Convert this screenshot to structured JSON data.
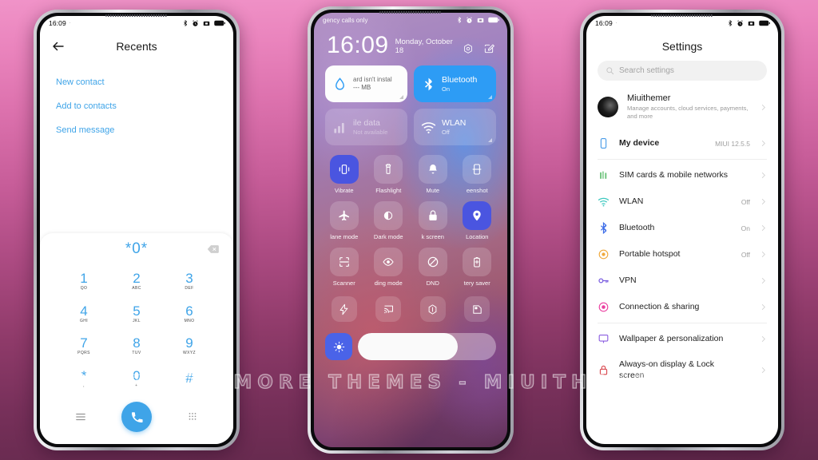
{
  "background": {
    "top_color": "#f093c8",
    "bottom_color": "#63294c"
  },
  "watermark": {
    "text": "VISIT FOR MORE THEMES - MIUITHEMER.COM"
  },
  "phone_left": {
    "statusbar": {
      "time": "16:09",
      "dot": "·",
      "icons": [
        "bluetooth-icon",
        "alarm-icon",
        "sd-card-icon",
        "battery-icon"
      ]
    },
    "dialer": {
      "back_icon": "back-arrow-icon",
      "title": "Recents",
      "actions": [
        {
          "label": "New contact"
        },
        {
          "label": "Add to contacts"
        },
        {
          "label": "Send message"
        }
      ],
      "display_number": "*0*",
      "delete_icon": "backspace-icon",
      "keys": [
        {
          "digit": "1",
          "letters": "QO"
        },
        {
          "digit": "2",
          "letters": "ABC"
        },
        {
          "digit": "3",
          "letters": "DEF"
        },
        {
          "digit": "4",
          "letters": "GHI"
        },
        {
          "digit": "5",
          "letters": "JKL"
        },
        {
          "digit": "6",
          "letters": "MNO"
        },
        {
          "digit": "7",
          "letters": "PQRS"
        },
        {
          "digit": "8",
          "letters": "TUV"
        },
        {
          "digit": "9",
          "letters": "WXYZ"
        },
        {
          "digit": "*",
          "letters": ","
        },
        {
          "digit": "0",
          "letters": "+"
        },
        {
          "digit": "#",
          "letters": ""
        }
      ],
      "bottom": {
        "menu_icon": "menu-lines-icon",
        "call_icon": "phone-call-icon",
        "keypad_icon": "keypad-dots-icon"
      },
      "accent_color": "#3fa4e8"
    }
  },
  "phone_center": {
    "statusbar": {
      "carrier": "gency calls only",
      "icons": [
        "bluetooth-icon",
        "alarm-icon",
        "sd-card-icon",
        "battery-icon"
      ]
    },
    "clock": "16:09",
    "date": "Monday, October 18",
    "header_icons": [
      "settings-gear-icon",
      "edit-pencil-icon"
    ],
    "big_tiles": [
      {
        "style": "white",
        "icon": "sd-card-water-icon",
        "title": "ard isn't instal",
        "subtitle": "--- MB"
      },
      {
        "style": "blue",
        "icon": "bluetooth-icon",
        "title": "Bluetooth",
        "subtitle": "On"
      },
      {
        "style": "dim",
        "icon": "signal-bars-icon",
        "title": "ile data",
        "subtitle": "Not available"
      },
      {
        "style": "dim",
        "icon": "wifi-icon",
        "title": "WLAN",
        "subtitle": "Off"
      }
    ],
    "tiles": [
      {
        "label": "Vibrate",
        "icon": "vibrate-icon",
        "active": true
      },
      {
        "label": "Flashlight",
        "icon": "flashlight-icon",
        "active": false
      },
      {
        "label": "Mute",
        "icon": "bell-icon",
        "active": false
      },
      {
        "label": "eenshot",
        "icon": "screenshot-icon",
        "active": false
      },
      {
        "label": "lane mode",
        "icon": "airplane-icon",
        "active": false
      },
      {
        "label": "Dark mode",
        "icon": "dark-mode-icon",
        "active": false
      },
      {
        "label": "k screen",
        "icon": "lock-icon",
        "active": false
      },
      {
        "label": "Location",
        "icon": "location-pin-icon",
        "active": true
      },
      {
        "label": "Scanner",
        "icon": "scanner-icon",
        "active": false
      },
      {
        "label": "ding mode",
        "icon": "eye-icon",
        "active": false
      },
      {
        "label": "DND",
        "icon": "dnd-icon",
        "active": false
      },
      {
        "label": "tery saver",
        "icon": "battery-saver-icon",
        "active": false
      }
    ],
    "mini_tiles": [
      {
        "icon": "lightning-bolt-icon"
      },
      {
        "icon": "cast-icon"
      },
      {
        "icon": "hexagon-slash-icon"
      },
      {
        "icon": "pip-window-icon"
      }
    ],
    "brightness": {
      "icon": "brightness-auto-icon",
      "level_percent": 72
    }
  },
  "phone_right": {
    "statusbar": {
      "time": "16:09",
      "dot": "·",
      "icons": [
        "bluetooth-icon",
        "alarm-icon",
        "sd-card-icon",
        "battery-icon"
      ]
    },
    "title": "Settings",
    "search": {
      "icon": "search-icon",
      "placeholder": "Search settings"
    },
    "account": {
      "avatar": "user-avatar",
      "name": "Miuithemer",
      "subtitle": "Manage accounts, cloud services, payments, and more"
    },
    "items": [
      {
        "label": "My device",
        "value": "MIUI 12.5.5",
        "icon": "phone-device-icon",
        "color": "#4a9ce8"
      },
      {
        "label": "SIM cards & mobile networks",
        "value": "",
        "icon": "sim-card-icon",
        "color": "#6bc27a"
      },
      {
        "label": "WLAN",
        "value": "Off",
        "icon": "wifi-icon",
        "color": "#3ec9c0"
      },
      {
        "label": "Bluetooth",
        "value": "On",
        "icon": "bluetooth-icon",
        "color": "#3f6ee8"
      },
      {
        "label": "Portable hotspot",
        "value": "Off",
        "icon": "hotspot-icon",
        "color": "#f0a93c"
      },
      {
        "label": "VPN",
        "value": "",
        "icon": "key-icon",
        "color": "#7a5de0"
      },
      {
        "label": "Connection & sharing",
        "value": "",
        "icon": "sharing-icon",
        "color": "#ea3fa0"
      },
      {
        "label": "Wallpaper & personalization",
        "value": "",
        "icon": "wallpaper-icon",
        "color": "#8b5de0"
      },
      {
        "label": "Always-on display & Lock screen",
        "value": "",
        "icon": "lock-icon",
        "color": "#d9484f"
      }
    ],
    "chevron_icon": "chevron-right-icon"
  }
}
